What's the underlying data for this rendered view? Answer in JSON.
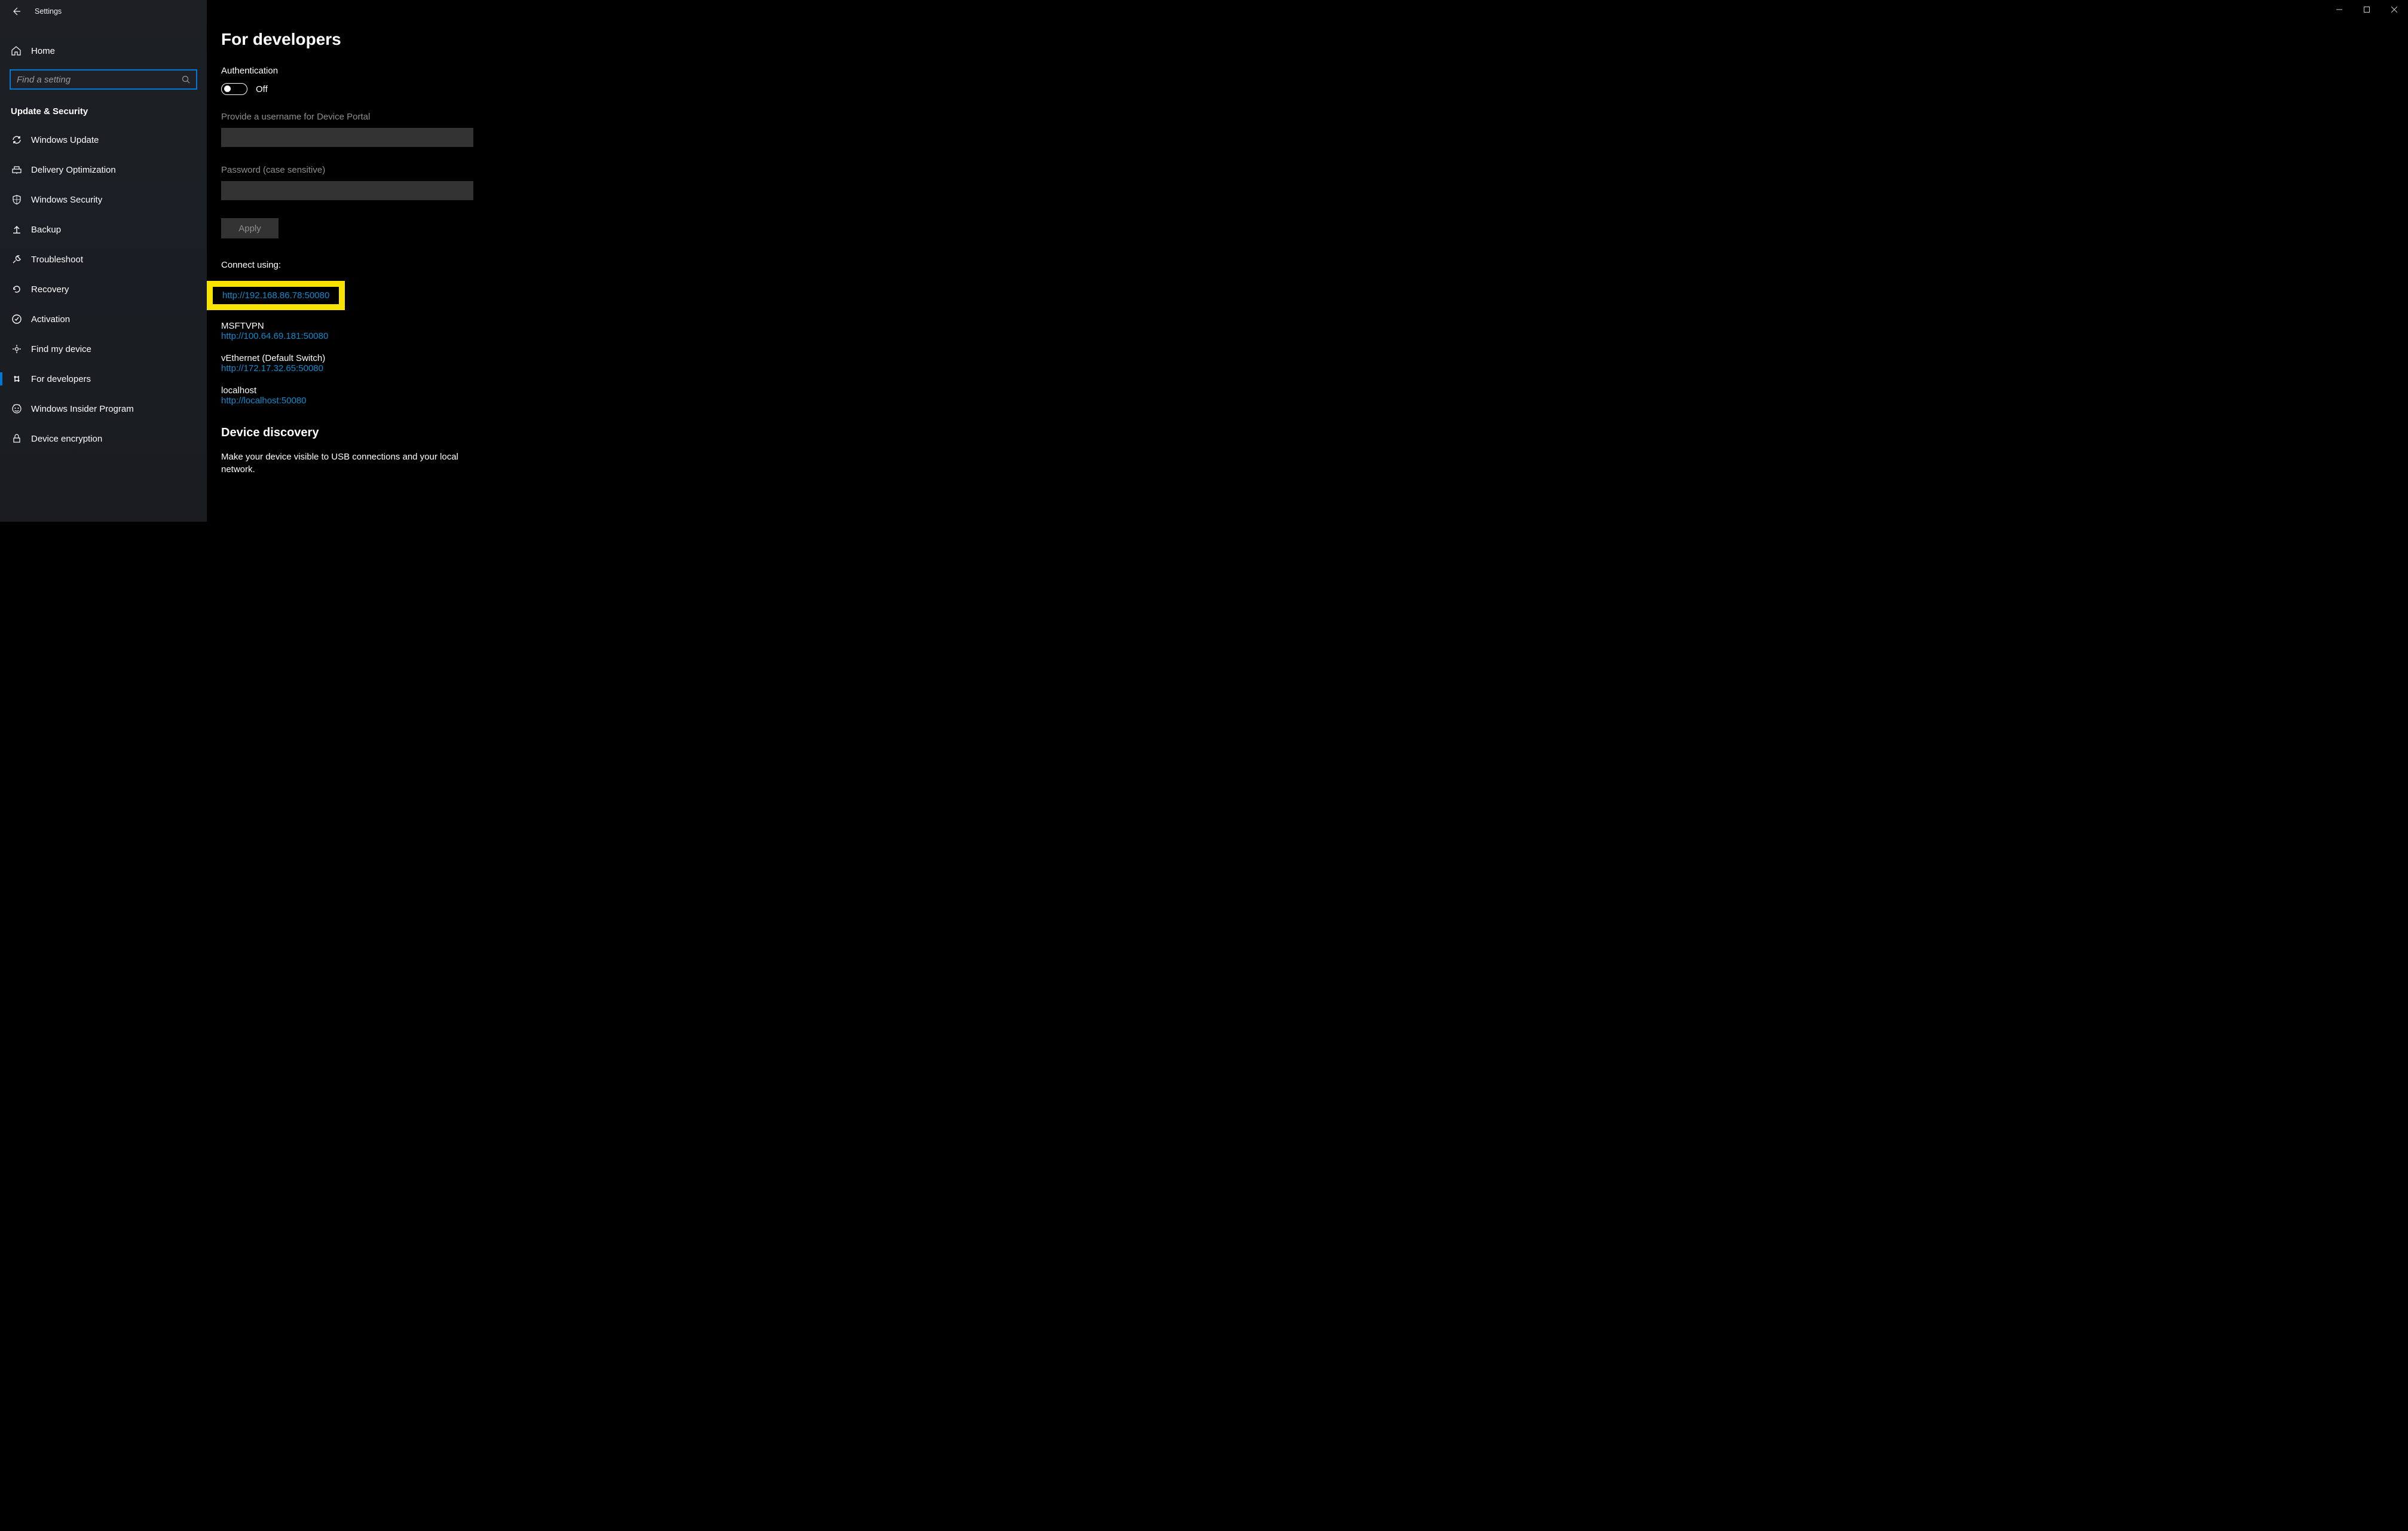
{
  "app_title": "Settings",
  "home_label": "Home",
  "search_placeholder": "Find a setting",
  "category_heading": "Update & Security",
  "nav_items": [
    {
      "label": "Windows Update",
      "icon": "sync"
    },
    {
      "label": "Delivery Optimization",
      "icon": "delivery"
    },
    {
      "label": "Windows Security",
      "icon": "shield"
    },
    {
      "label": "Backup",
      "icon": "backup"
    },
    {
      "label": "Troubleshoot",
      "icon": "troubleshoot"
    },
    {
      "label": "Recovery",
      "icon": "recovery"
    },
    {
      "label": "Activation",
      "icon": "activation"
    },
    {
      "label": "Find my device",
      "icon": "findmydevice"
    },
    {
      "label": "For developers",
      "icon": "developers"
    },
    {
      "label": "Windows Insider Program",
      "icon": "insider"
    },
    {
      "label": "Device encryption",
      "icon": "encryption"
    }
  ],
  "active_nav_index": 8,
  "page_title": "For developers",
  "auth": {
    "heading": "Authentication",
    "toggle_state": "Off",
    "username_label": "Provide a username for Device Portal",
    "password_label": "Password (case sensitive)",
    "apply_label": "Apply"
  },
  "connect": {
    "heading": "Connect using:",
    "entries": [
      {
        "label": "",
        "url": "http://192.168.86.78:50080",
        "highlight": true
      },
      {
        "label": "MSFTVPN",
        "url": "http://100.64.69.181:50080"
      },
      {
        "label": "vEthernet (Default Switch)",
        "url": "http://172.17.32.65:50080"
      },
      {
        "label": "localhost",
        "url": "http://localhost:50080"
      }
    ]
  },
  "device_discovery": {
    "heading": "Device discovery",
    "text": "Make your device visible to USB connections and your local network."
  }
}
